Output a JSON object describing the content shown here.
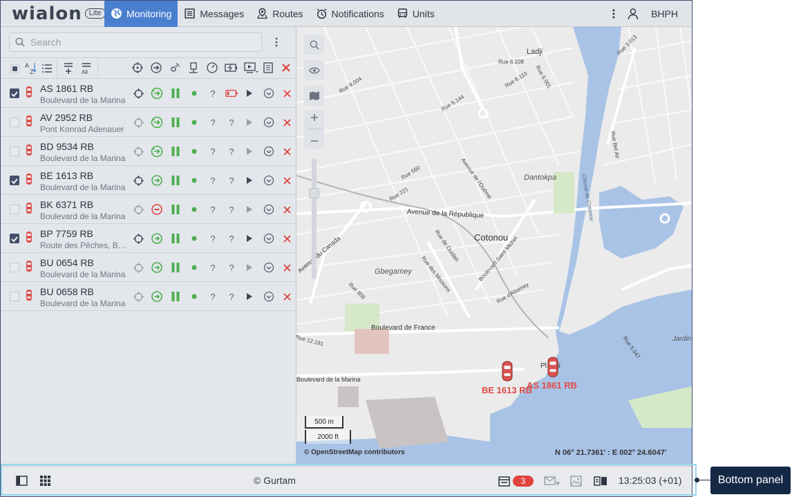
{
  "app": {
    "logo_text": "wialon",
    "logo_badge": "Lite"
  },
  "nav": {
    "tabs": [
      {
        "label": "Monitoring",
        "active": true
      },
      {
        "label": "Messages"
      },
      {
        "label": "Routes"
      },
      {
        "label": "Notifications"
      },
      {
        "label": "Units"
      }
    ],
    "user": "BHPH"
  },
  "search": {
    "placeholder": "Search"
  },
  "units": [
    {
      "name": "AS 1861 RB",
      "address": "Boulevard de la Marina",
      "checked": true,
      "motion": "moving",
      "battery": true,
      "play": true
    },
    {
      "name": "AV 2952 RB",
      "address": "Pont Konrad Adenauer",
      "checked": false,
      "motion": "moving",
      "battery": false,
      "play": false
    },
    {
      "name": "BD 9534 RB",
      "address": "Boulevard de la Marina",
      "checked": false,
      "motion": "moving",
      "battery": false,
      "play": false
    },
    {
      "name": "BE 1613 RB",
      "address": "Boulevard de la Marina",
      "checked": true,
      "motion": "stopped",
      "battery": false,
      "play": true
    },
    {
      "name": "BK 6371 RB",
      "address": "Boulevard de la Marina",
      "checked": false,
      "motion": "blocked",
      "battery": false,
      "play": false
    },
    {
      "name": "BP 7759 RB",
      "address": "Route des Pêches, Bel Air",
      "checked": true,
      "motion": "stopped",
      "battery": false,
      "play": true
    },
    {
      "name": "BU 0654 RB",
      "address": "Boulevard de la Marina",
      "checked": false,
      "motion": "stopped",
      "battery": false,
      "play": false
    },
    {
      "name": "BU 0658 RB",
      "address": "Boulevard de la Marina",
      "checked": false,
      "motion": "stopped",
      "battery": false,
      "play": true
    }
  ],
  "map": {
    "labels": {
      "city": "Cotonou",
      "ladji": "Ladji",
      "dantokpa": "Dantokpa",
      "gbegamey": "Gbegamey",
      "jardin": "Jardin",
      "boulevard_france": "Boulevard de France",
      "avenue_republique": "Avenue de la République",
      "avenue_canada": "Avenue du Canada",
      "boulevard_marina": "Boulevard de la Marina",
      "rue_9004": "Rue 9.004",
      "rue_6144": "Rue 6.144",
      "rue_6108": "Rue 6.108",
      "rue_6110": "Rue 6.110",
      "rue_6001": "Rue 6.001",
      "rue_3013": "Rue 3.013",
      "rue_560": "Rue 560",
      "rue_221": "Rue 221",
      "rue_808": "Rue 808",
      "rue_12191": "Rue 12.191",
      "rue_5047": "Rue 5.047",
      "rue_bel_air": "Rue Bel Air",
      "chenal": "Chenal de Cotonou",
      "rue_ouidah": "Rue de Ouidah",
      "rue_missions": "Rue des Missions",
      "bd_saint_michel": "Boulevard Saint Michel",
      "avenue_ouemé": "Avenue de l'Ouémé",
      "rue_abomey": "Rue d'Abomey",
      "poste_fragment": "Pl…dji"
    },
    "markers": [
      {
        "label": "BE 1613 RB"
      },
      {
        "label": "AS 1861 RB"
      }
    ],
    "scale": {
      "metric": "500 m",
      "imperial": "2000 ft"
    },
    "attribution": "© OpenStreetMap contributors",
    "coords": "N 06° 21.7361' : E 002° 24.6047'"
  },
  "bottom": {
    "copyright": "© Gurtam",
    "notification_count": "3",
    "time": "13:25:03 (+01)"
  },
  "annotation": {
    "label": "Bottom panel"
  },
  "colors": {
    "accent": "#4a7fd0",
    "ok_green": "#4caf50",
    "alert_red": "#e0443f",
    "callout_bg": "#152845"
  }
}
